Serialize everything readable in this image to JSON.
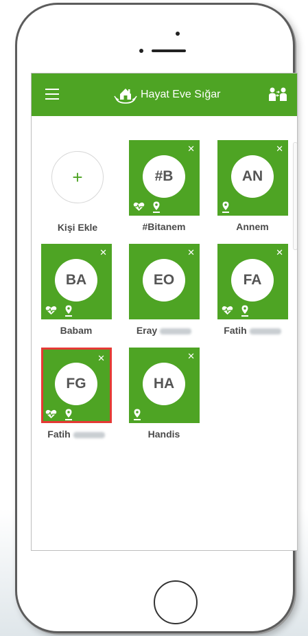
{
  "app": {
    "title": "Hayat Eve Sığar",
    "colors": {
      "primary": "#4ea424",
      "selected_border": "#e53935",
      "label_text": "#4a4a4a"
    }
  },
  "toolbar": {
    "menu_icon": "hamburger-menu-icon",
    "logo_icon": "house-in-hands-icon",
    "switch_icon": "people-switch-icon"
  },
  "add_contact": {
    "symbol": "+",
    "label": "Kişi Ekle"
  },
  "contacts": [
    {
      "initials": "#B",
      "name": "#Bitanem",
      "surname_obscured": false,
      "health_icon": true,
      "location_icon": true,
      "selected": false
    },
    {
      "initials": "AN",
      "name": "Annem",
      "surname_obscured": false,
      "health_icon": false,
      "location_icon": true,
      "selected": false
    },
    {
      "initials": "BA",
      "name": "Babam",
      "surname_obscured": false,
      "health_icon": true,
      "location_icon": true,
      "selected": false
    },
    {
      "initials": "EO",
      "name": "Eray",
      "surname_obscured": true,
      "health_icon": false,
      "location_icon": false,
      "selected": false
    },
    {
      "initials": "FA",
      "name": "Fatih",
      "surname_obscured": true,
      "health_icon": true,
      "location_icon": true,
      "selected": false
    },
    {
      "initials": "FG",
      "name": "Fatih",
      "surname_obscured": true,
      "health_icon": true,
      "location_icon": true,
      "selected": true
    },
    {
      "initials": "HA",
      "name": "Handis",
      "surname_obscured": false,
      "health_icon": false,
      "location_icon": true,
      "selected": false
    }
  ],
  "tile_close_symbol": "✕"
}
